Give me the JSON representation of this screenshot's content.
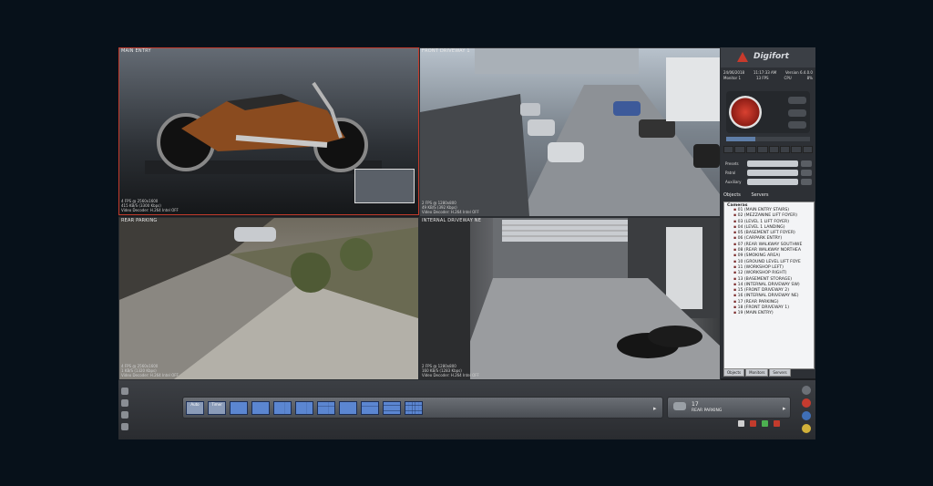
{
  "cameras": [
    {
      "title": "MAIN ENTRY",
      "stats": "4 FPS @ 2560x1600\n415 KB/S (3300 Kbps)\nVideo Decoder: H.264 Intel OFF"
    },
    {
      "title": "FRONT DRIVEWAY 1",
      "stats": "2 FPS @ 1280x800\n49 KB/S (392 Kbps)\nVideo Decoder: H.264 Intel OFF"
    },
    {
      "title": "REAR PARKING",
      "stats": "4 FPS @ 2560x1600\n1 KB/S (1320 Kbps)\nVideo Decoder: H.264 Intel OFF"
    },
    {
      "title": "INTERNAL DRIVEWAY NE",
      "stats": "2 FPS @ 1280x800\n160 KB/S (1283 Kbps)\nVideo Decoder: H.264 Intel OFF"
    }
  ],
  "panel": {
    "brand": "Digifort",
    "date": "24/06/2018",
    "time": "11:17:33 AM",
    "version": "Version 6.4.0.0",
    "monitor": "Monitor 1",
    "fps": "13 FPS",
    "cpu_label": "CPU",
    "cpu_value": "8%",
    "presets_label": "Presets",
    "patrol_label": "Patrol",
    "auxiliary_label": "Auxiliary",
    "tab_objects": "Objects",
    "tab_servers": "Servers",
    "tree_root": "Cameras",
    "tree_items": [
      "01 (MAIN ENTRY STAIRS)",
      "02 (MEZZANINE LIFT FOYER)",
      "03 (LEVEL 1 LIFT FOYER)",
      "04 (LEVEL 1 LANDING)",
      "05 (BASEMENT LIFT FOYER)",
      "06 (CARPARK ENTRY)",
      "07 (REAR WALKWAY SOUTHWE",
      "08 (REAR WALKWAY NORTHEA",
      "09 (SMOKING AREA)",
      "10 (GROUND LEVEL LIFT FOYE",
      "11 (WORKSHOP LEFT)",
      "12 (WORKSHOP RIGHT)",
      "13 (BASEMENT STORAGE)",
      "14 (INTERNAL DRIVEWAY SW)",
      "15 (FRONT DRIVEWAY 2)",
      "16 (INTERNAL DRIVEWAY NE)",
      "17 (REAR PARKING)",
      "18 (FRONT DRIVEWAY 1)",
      "19 (MAIN ENTRY)"
    ],
    "bottom_tabs": [
      "Objects",
      "Monitors",
      "Servers"
    ]
  },
  "toolbar": {
    "auto_label": "Auto",
    "timer_label": "Timer",
    "selected_camera_number": "17",
    "selected_camera_name": "REAR PARKING"
  },
  "colors": {
    "accent_red": "#c83a2c",
    "layout_blue": "#5b86d1",
    "panel_bg": "#2d3035"
  }
}
